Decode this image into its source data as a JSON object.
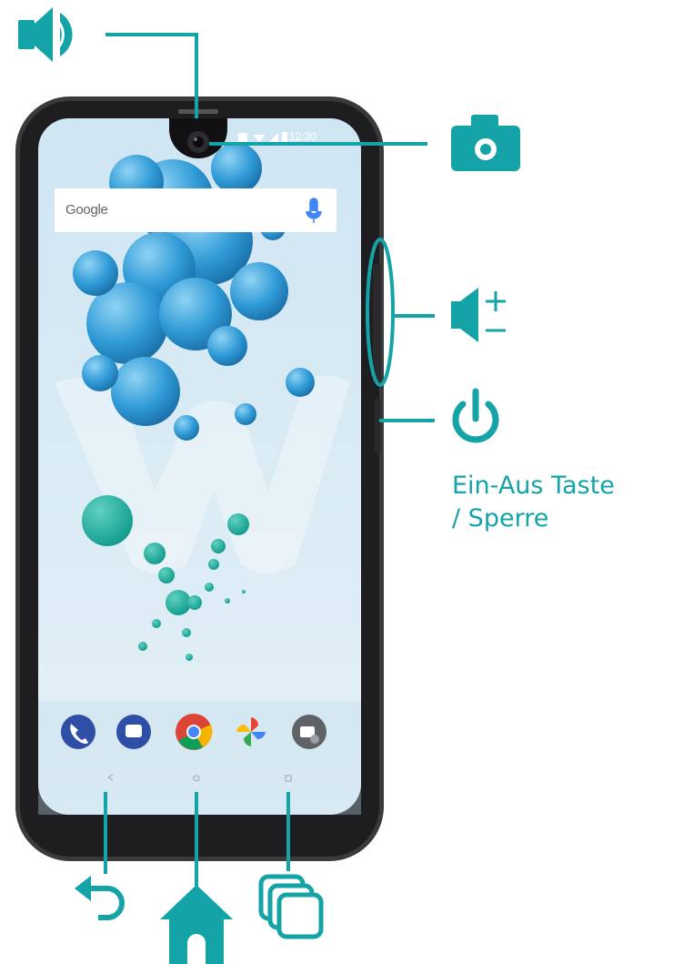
{
  "colors": {
    "accent": "#14a3a6",
    "phone_body": "#2b2b2b",
    "screen_bg": "#d9ecf4",
    "bubble": "#3aa3d8"
  },
  "labels": {
    "power_label_line1": "Ein-Aus Taste",
    "power_label_line2": "/ Sperre",
    "google_search": "Google",
    "status_time": "12:30"
  },
  "callouts": [
    {
      "name": "speaker-icon",
      "points_to": "earpiece"
    },
    {
      "name": "camera-icon",
      "points_to": "front-camera"
    },
    {
      "name": "volume-icon",
      "points_to": "volume-buttons"
    },
    {
      "name": "power-icon",
      "points_to": "power-button"
    },
    {
      "name": "back-icon",
      "points_to": "back-button"
    },
    {
      "name": "home-icon",
      "points_to": "home-button"
    },
    {
      "name": "recent-apps-icon",
      "points_to": "recents-button"
    }
  ],
  "dock_apps": [
    "phone-icon",
    "messages-icon",
    "chrome-icon",
    "photos-icon",
    "camera-app-icon"
  ]
}
